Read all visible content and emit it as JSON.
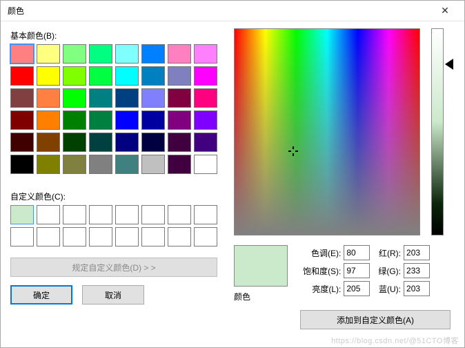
{
  "title": "颜色",
  "close_glyph": "✕",
  "basic_label": "基本颜色(B):",
  "basic_colors": [
    "#ff8080",
    "#ffff80",
    "#80ff80",
    "#00ff80",
    "#80ffff",
    "#0080ff",
    "#ff80c0",
    "#ff80ff",
    "#ff0000",
    "#ffff00",
    "#80ff00",
    "#00ff40",
    "#00ffff",
    "#0080c0",
    "#8080c0",
    "#ff00ff",
    "#804040",
    "#ff8040",
    "#00ff00",
    "#008080",
    "#004080",
    "#8080ff",
    "#800040",
    "#ff0080",
    "#800000",
    "#ff8000",
    "#008000",
    "#008040",
    "#0000ff",
    "#0000a0",
    "#800080",
    "#8000ff",
    "#400000",
    "#804000",
    "#004000",
    "#004040",
    "#000080",
    "#000040",
    "#400040",
    "#400080",
    "#000000",
    "#808000",
    "#808040",
    "#808080",
    "#408080",
    "#c0c0c0",
    "#400040",
    "#ffffff"
  ],
  "basic_selected_index": 0,
  "custom_label": "自定义颜色(C):",
  "custom_colors_count": 16,
  "custom_selected_index": 0,
  "custom_selected_color": "#cbe9cb",
  "define_button": "规定自定义颜色(D) > >",
  "ok_button": "确定",
  "cancel_button": "取消",
  "preview_label": "颜色",
  "fields": {
    "hue_label": "色调(E):",
    "hue": "80",
    "sat_label": "饱和度(S):",
    "sat": "97",
    "lum_label": "亮度(L):",
    "lum": "205",
    "red_label": "红(R):",
    "red": "203",
    "green_label": "绿(G):",
    "green": "233",
    "blue_label": "蓝(U):",
    "blue": "203"
  },
  "add_button": "添加到自定义颜色(A)",
  "watermark": "https://blog.csdn.net/@51CTO博客"
}
